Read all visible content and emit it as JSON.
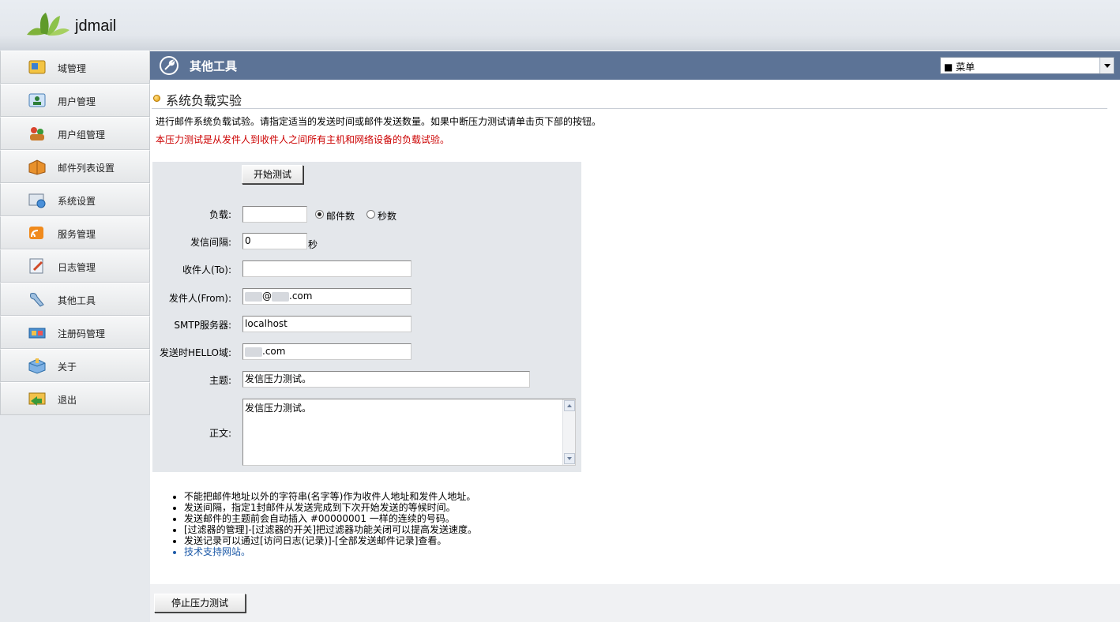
{
  "header": {
    "brand": "jdmail"
  },
  "sidebar": {
    "items": [
      {
        "label": "域管理",
        "icon": "domain-icon"
      },
      {
        "label": "用户管理",
        "icon": "user-icon"
      },
      {
        "label": "用户组管理",
        "icon": "user-group-icon"
      },
      {
        "label": "邮件列表设置",
        "icon": "mailing-list-icon"
      },
      {
        "label": "系统设置",
        "icon": "system-settings-icon"
      },
      {
        "label": "服务管理",
        "icon": "service-icon"
      },
      {
        "label": "日志管理",
        "icon": "log-icon"
      },
      {
        "label": "其他工具",
        "icon": "tools-icon"
      },
      {
        "label": "注册码管理",
        "icon": "license-icon"
      },
      {
        "label": "关于",
        "icon": "about-icon"
      },
      {
        "label": "退出",
        "icon": "logout-icon"
      }
    ]
  },
  "titlebar": {
    "title": "其他工具",
    "menu_value": "■ 菜单"
  },
  "section": {
    "title": "系统负载实验",
    "description": "进行邮件系统负载试验。请指定适当的发送时间或邮件发送数量。如果中断压力测试请单击页下部的按钮。",
    "warning": "本压力测试是从发件人到收件人之间所有主机和网络设备的负载试验。"
  },
  "form": {
    "start_button": "开始测试",
    "load_label": "负载:",
    "load_value": "",
    "radio_mail_count": "邮件数",
    "radio_seconds": "秒数",
    "interval_label": "发信间隔:",
    "interval_value": "0",
    "interval_unit": "秒",
    "to_label": "收件人(To):",
    "to_value": "",
    "from_label": "发件人(From):",
    "from_value_mid": "@",
    "from_value_end": ".com",
    "smtp_label": "SMTP服务器:",
    "smtp_value": "localhost",
    "hello_label": "发送时HELLO域:",
    "hello_value_end": ".com",
    "subject_label": "主题:",
    "subject_value": "发信压力测试。",
    "body_label": "正文:",
    "body_value": "发信压力测试。"
  },
  "notes": [
    "不能把邮件地址以外的字符串(名字等)作为收件人地址和发件人地址。",
    "发送间隔，指定1封邮件从发送完成到下次开始发送的等候时间。",
    "发送邮件的主题前会自动插入 #00000001 一样的连续的号码。",
    "[过滤器的管理]-[过滤器的开关]把过滤器功能关闭可以提高发送速度。",
    "发送记录可以通过[访问日志(记录)]-[全部发送邮件记录]查看。"
  ],
  "support_link": "技术支持网站。",
  "stop_button": "停止压力测试"
}
